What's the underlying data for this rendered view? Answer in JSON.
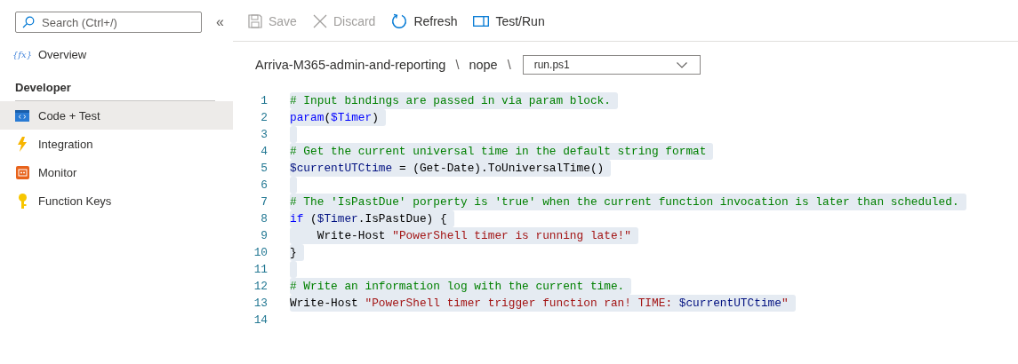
{
  "sidebar": {
    "search": {
      "placeholder": "Search (Ctrl+/)"
    },
    "collapse": "«",
    "items": [
      {
        "kind": "item",
        "icon_text": "{fx}",
        "label": "Overview",
        "selected": false
      },
      {
        "kind": "section",
        "label": "Developer"
      },
      {
        "kind": "item",
        "label": "Code + Test",
        "selected": true
      },
      {
        "kind": "item",
        "label": "Integration",
        "selected": false
      },
      {
        "kind": "item",
        "label": "Monitor",
        "selected": false
      },
      {
        "kind": "item",
        "label": "Function Keys",
        "selected": false
      }
    ]
  },
  "toolbar": [
    {
      "label": "Save",
      "disabled": true
    },
    {
      "label": "Discard",
      "disabled": true
    },
    {
      "label": "Refresh",
      "disabled": false
    },
    {
      "label": "Test/Run",
      "disabled": false
    }
  ],
  "breadcrumb": [
    {
      "kind": "segment",
      "text": "Arriva-M365-admin-and-reporting"
    },
    {
      "kind": "separator",
      "text": "\\"
    },
    {
      "kind": "segment",
      "text": "nope"
    },
    {
      "kind": "separator",
      "text": "\\"
    }
  ],
  "file_dropdown": {
    "value": "run.ps1"
  },
  "editor": {
    "lines": [
      {
        "number": "1",
        "selected": true,
        "tokens": [
          {
            "kind": "comment",
            "text": "# Input bindings are passed in via param block."
          }
        ]
      },
      {
        "number": "2",
        "selected": true,
        "tokens": [
          {
            "kind": "keyword",
            "text": "param"
          },
          {
            "kind": "plain",
            "text": "("
          },
          {
            "kind": "keyword",
            "text": "$Timer"
          },
          {
            "kind": "plain",
            "text": ")"
          }
        ]
      },
      {
        "number": "3",
        "selected": true
      },
      {
        "number": "4",
        "selected": true,
        "tokens": [
          {
            "kind": "comment",
            "text": "# Get the current universal time in the default string format"
          }
        ]
      },
      {
        "number": "5",
        "selected": true,
        "tokens": [
          {
            "kind": "variable",
            "text": "$currentUTCtime"
          },
          {
            "kind": "plain",
            "text": " = (Get-Date).ToUniversalTime()"
          }
        ]
      },
      {
        "number": "6",
        "selected": true
      },
      {
        "number": "7",
        "selected": true,
        "tokens": [
          {
            "kind": "comment",
            "text": "# The 'IsPastDue' porperty is 'true' when the current function invocation is later than scheduled."
          }
        ]
      },
      {
        "number": "8",
        "selected": true,
        "tokens": [
          {
            "kind": "keyword",
            "text": "if"
          },
          {
            "kind": "plain",
            "text": " ("
          },
          {
            "kind": "variable",
            "text": "$Timer"
          },
          {
            "kind": "plain",
            "text": ".IsPastDue) {"
          }
        ]
      },
      {
        "number": "9",
        "selected": true,
        "tokens": [
          {
            "kind": "plain",
            "text": "    Write-Host "
          },
          {
            "kind": "string",
            "text": "\"PowerShell timer is running late!\""
          }
        ]
      },
      {
        "number": "10",
        "selected": true,
        "tokens": [
          {
            "kind": "plain",
            "text": "}"
          }
        ]
      },
      {
        "number": "11",
        "selected": true
      },
      {
        "number": "12",
        "selected": true,
        "tokens": [
          {
            "kind": "comment",
            "text": "# Write an information log with the current time."
          }
        ]
      },
      {
        "number": "13",
        "selected": true,
        "tokens": [
          {
            "kind": "plain",
            "text": "Write-Host "
          },
          {
            "kind": "string",
            "text": "\"PowerShell timer trigger function ran! TIME: "
          },
          {
            "kind": "variable",
            "text": "$currentUTCtime"
          },
          {
            "kind": "string",
            "text": "\""
          }
        ]
      },
      {
        "number": "14",
        "selected": false
      }
    ]
  }
}
